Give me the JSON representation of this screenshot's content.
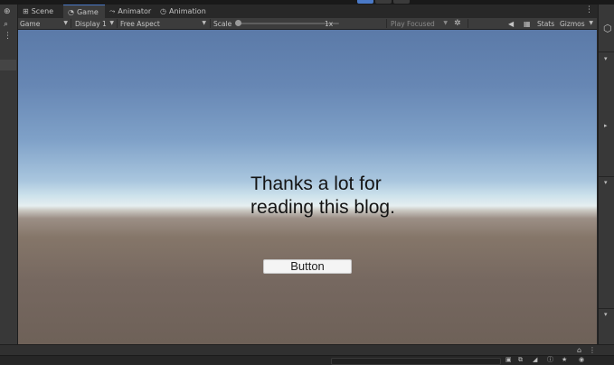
{
  "tabs": [
    {
      "label": "Scene",
      "icon": "grid-icon"
    },
    {
      "label": "Game",
      "icon": "gamepad-icon",
      "active": true
    },
    {
      "label": "Animator",
      "icon": "animator-icon"
    },
    {
      "label": "Animation",
      "icon": "clock-icon"
    }
  ],
  "toolbar": {
    "display_mode": "Game",
    "display": "Display 1",
    "aspect": "Free Aspect",
    "scale_label": "Scale",
    "scale_value": "1x",
    "play_mode": "Play Focused",
    "stats": "Stats",
    "gizmos": "Gizmos"
  },
  "game": {
    "message": "Thanks a lot for reading this blog.",
    "button_label": "Button"
  },
  "colors": {
    "accent": "#4a79c7",
    "sky_top": "#5b7aa8",
    "horizon": "#e6eef0",
    "ground": "#766860"
  }
}
